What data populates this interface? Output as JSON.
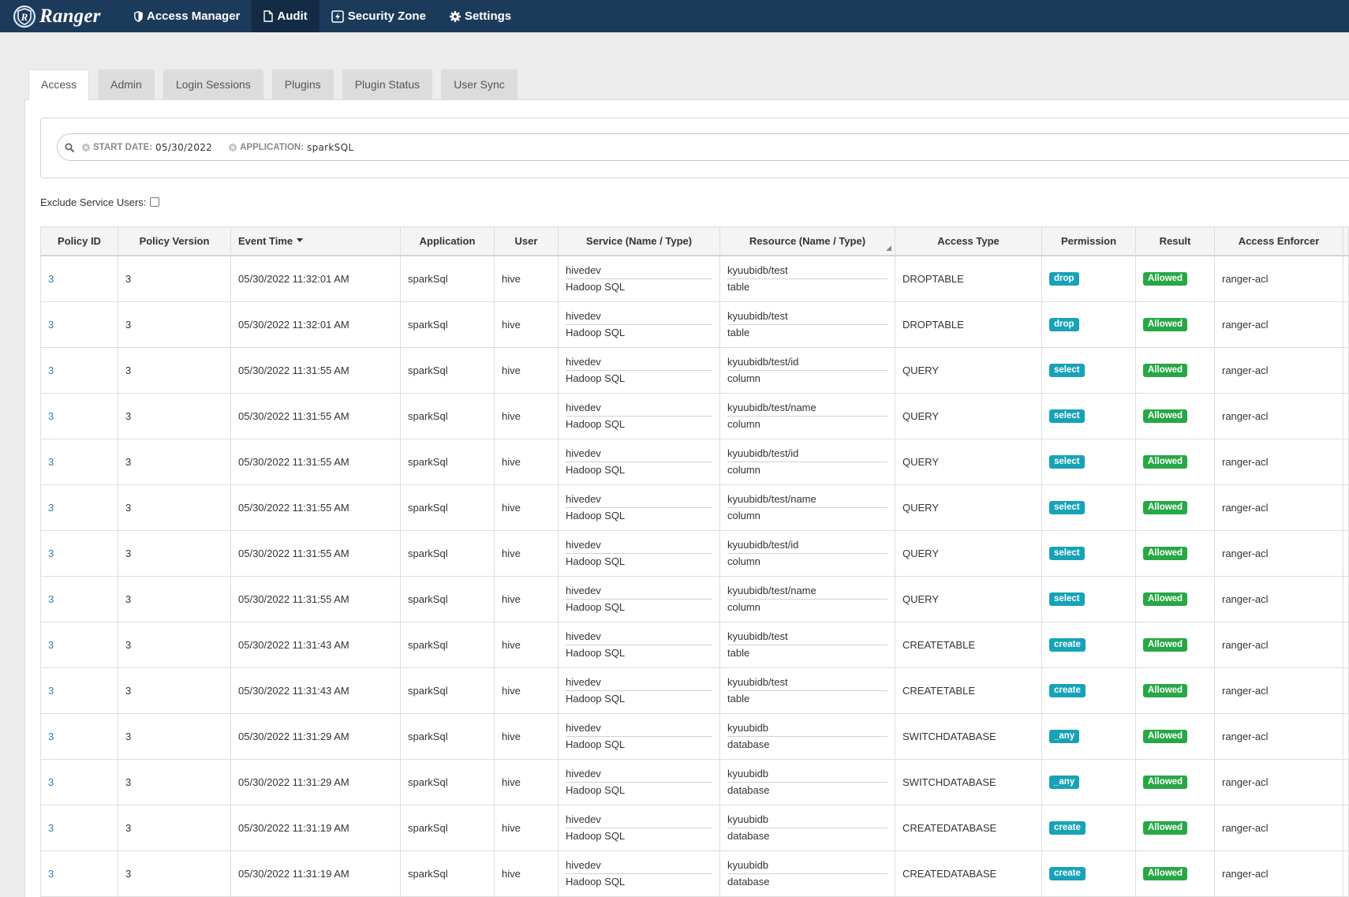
{
  "app": {
    "name": "Ranger"
  },
  "nav": {
    "items": [
      {
        "label": "Access Manager",
        "icon": "shield-icon",
        "active": false
      },
      {
        "label": "Audit",
        "icon": "file-icon",
        "active": true
      },
      {
        "label": "Security Zone",
        "icon": "lightning-icon",
        "active": false
      },
      {
        "label": "Settings",
        "icon": "gear-icon",
        "active": false
      }
    ]
  },
  "tabs": [
    {
      "label": "Access",
      "active": true
    },
    {
      "label": "Admin",
      "active": false
    },
    {
      "label": "Login Sessions",
      "active": false
    },
    {
      "label": "Plugins",
      "active": false
    },
    {
      "label": "Plugin Status",
      "active": false
    },
    {
      "label": "User Sync",
      "active": false
    }
  ],
  "search": {
    "icon": "search-icon",
    "filters": [
      {
        "key": "START DATE:",
        "value": "05/30/2022",
        "remove_icon": "close-circle-icon"
      },
      {
        "key": "APPLICATION:",
        "value": "sparkSQL",
        "remove_icon": "close-circle-icon"
      }
    ]
  },
  "exclude_service_users": {
    "label": "Exclude Service Users:",
    "checked": false
  },
  "table": {
    "columns": [
      "Policy ID",
      "Policy Version",
      "Event Time",
      "Application",
      "User",
      "Service (Name / Type)",
      "Resource (Name / Type)",
      "Access Type",
      "Permission",
      "Result",
      "Access Enforcer"
    ],
    "sort": {
      "column_index": 2,
      "icon": "sort-desc-icon"
    },
    "rows": [
      {
        "policy_id": "3",
        "policy_version": "3",
        "event_time": "05/30/2022 11:32:01 AM",
        "application": "sparkSql",
        "user": "hive",
        "service_name": "hivedev",
        "service_type": "Hadoop SQL",
        "resource_name": "kyuubidb/test",
        "resource_type": "table",
        "access_type": "DROPTABLE",
        "permission": "drop",
        "result": "Allowed",
        "access_enforcer": "ranger-acl"
      },
      {
        "policy_id": "3",
        "policy_version": "3",
        "event_time": "05/30/2022 11:32:01 AM",
        "application": "sparkSql",
        "user": "hive",
        "service_name": "hivedev",
        "service_type": "Hadoop SQL",
        "resource_name": "kyuubidb/test",
        "resource_type": "table",
        "access_type": "DROPTABLE",
        "permission": "drop",
        "result": "Allowed",
        "access_enforcer": "ranger-acl"
      },
      {
        "policy_id": "3",
        "policy_version": "3",
        "event_time": "05/30/2022 11:31:55 AM",
        "application": "sparkSql",
        "user": "hive",
        "service_name": "hivedev",
        "service_type": "Hadoop SQL",
        "resource_name": "kyuubidb/test/id",
        "resource_type": "column",
        "access_type": "QUERY",
        "permission": "select",
        "result": "Allowed",
        "access_enforcer": "ranger-acl"
      },
      {
        "policy_id": "3",
        "policy_version": "3",
        "event_time": "05/30/2022 11:31:55 AM",
        "application": "sparkSql",
        "user": "hive",
        "service_name": "hivedev",
        "service_type": "Hadoop SQL",
        "resource_name": "kyuubidb/test/name",
        "resource_type": "column",
        "access_type": "QUERY",
        "permission": "select",
        "result": "Allowed",
        "access_enforcer": "ranger-acl"
      },
      {
        "policy_id": "3",
        "policy_version": "3",
        "event_time": "05/30/2022 11:31:55 AM",
        "application": "sparkSql",
        "user": "hive",
        "service_name": "hivedev",
        "service_type": "Hadoop SQL",
        "resource_name": "kyuubidb/test/id",
        "resource_type": "column",
        "access_type": "QUERY",
        "permission": "select",
        "result": "Allowed",
        "access_enforcer": "ranger-acl"
      },
      {
        "policy_id": "3",
        "policy_version": "3",
        "event_time": "05/30/2022 11:31:55 AM",
        "application": "sparkSql",
        "user": "hive",
        "service_name": "hivedev",
        "service_type": "Hadoop SQL",
        "resource_name": "kyuubidb/test/name",
        "resource_type": "column",
        "access_type": "QUERY",
        "permission": "select",
        "result": "Allowed",
        "access_enforcer": "ranger-acl"
      },
      {
        "policy_id": "3",
        "policy_version": "3",
        "event_time": "05/30/2022 11:31:55 AM",
        "application": "sparkSql",
        "user": "hive",
        "service_name": "hivedev",
        "service_type": "Hadoop SQL",
        "resource_name": "kyuubidb/test/id",
        "resource_type": "column",
        "access_type": "QUERY",
        "permission": "select",
        "result": "Allowed",
        "access_enforcer": "ranger-acl"
      },
      {
        "policy_id": "3",
        "policy_version": "3",
        "event_time": "05/30/2022 11:31:55 AM",
        "application": "sparkSql",
        "user": "hive",
        "service_name": "hivedev",
        "service_type": "Hadoop SQL",
        "resource_name": "kyuubidb/test/name",
        "resource_type": "column",
        "access_type": "QUERY",
        "permission": "select",
        "result": "Allowed",
        "access_enforcer": "ranger-acl"
      },
      {
        "policy_id": "3",
        "policy_version": "3",
        "event_time": "05/30/2022 11:31:43 AM",
        "application": "sparkSql",
        "user": "hive",
        "service_name": "hivedev",
        "service_type": "Hadoop SQL",
        "resource_name": "kyuubidb/test",
        "resource_type": "table",
        "access_type": "CREATETABLE",
        "permission": "create",
        "result": "Allowed",
        "access_enforcer": "ranger-acl"
      },
      {
        "policy_id": "3",
        "policy_version": "3",
        "event_time": "05/30/2022 11:31:43 AM",
        "application": "sparkSql",
        "user": "hive",
        "service_name": "hivedev",
        "service_type": "Hadoop SQL",
        "resource_name": "kyuubidb/test",
        "resource_type": "table",
        "access_type": "CREATETABLE",
        "permission": "create",
        "result": "Allowed",
        "access_enforcer": "ranger-acl"
      },
      {
        "policy_id": "3",
        "policy_version": "3",
        "event_time": "05/30/2022 11:31:29 AM",
        "application": "sparkSql",
        "user": "hive",
        "service_name": "hivedev",
        "service_type": "Hadoop SQL",
        "resource_name": "kyuubidb",
        "resource_type": "database",
        "access_type": "SWITCHDATABASE",
        "permission": "_any",
        "result": "Allowed",
        "access_enforcer": "ranger-acl"
      },
      {
        "policy_id": "3",
        "policy_version": "3",
        "event_time": "05/30/2022 11:31:29 AM",
        "application": "sparkSql",
        "user": "hive",
        "service_name": "hivedev",
        "service_type": "Hadoop SQL",
        "resource_name": "kyuubidb",
        "resource_type": "database",
        "access_type": "SWITCHDATABASE",
        "permission": "_any",
        "result": "Allowed",
        "access_enforcer": "ranger-acl"
      },
      {
        "policy_id": "3",
        "policy_version": "3",
        "event_time": "05/30/2022 11:31:19 AM",
        "application": "sparkSql",
        "user": "hive",
        "service_name": "hivedev",
        "service_type": "Hadoop SQL",
        "resource_name": "kyuubidb",
        "resource_type": "database",
        "access_type": "CREATEDATABASE",
        "permission": "create",
        "result": "Allowed",
        "access_enforcer": "ranger-acl"
      },
      {
        "policy_id": "3",
        "policy_version": "3",
        "event_time": "05/30/2022 11:31:19 AM",
        "application": "sparkSql",
        "user": "hive",
        "service_name": "hivedev",
        "service_type": "Hadoop SQL",
        "resource_name": "kyuubidb",
        "resource_type": "database",
        "access_type": "CREATEDATABASE",
        "permission": "create",
        "result": "Allowed",
        "access_enforcer": "ranger-acl"
      }
    ]
  },
  "colors": {
    "nav_background": "#1c3a5a",
    "nav_active_background": "#132b45",
    "link": "#337ab7",
    "permission_badge": "#17a2b8",
    "result_allowed": "#28a745"
  }
}
